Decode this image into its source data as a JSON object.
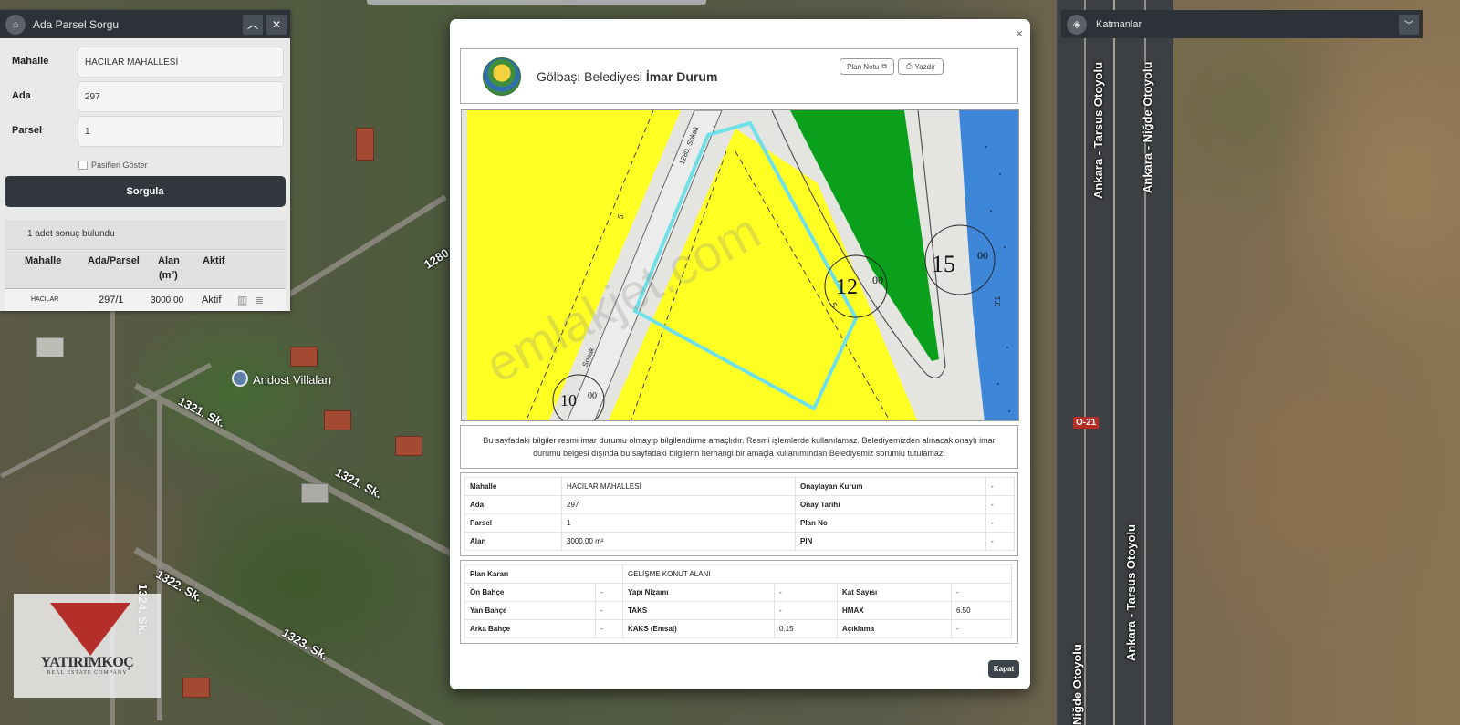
{
  "panel": {
    "title": "Ada Parsel Sorgu",
    "icon": "home-icon",
    "fields": [
      {
        "label": "Mahalle",
        "value": "HACILAR MAHALLESİ"
      },
      {
        "label": "Ada",
        "value": "297"
      },
      {
        "label": "Parsel",
        "value": "1"
      }
    ],
    "pasif_label": "Pasifleri Göster",
    "button": "Sorgula",
    "result_count": "1 adet sonuç bulundu",
    "columns": [
      "Mahalle",
      "Ada/Parsel",
      "Alan",
      "(m²)",
      "Aktif"
    ],
    "row": {
      "mahalle": "HACILAR",
      "ada_parsel": "297/1",
      "alan": "3000.00",
      "aktif": "Aktif"
    }
  },
  "layers": {
    "title": "Katmanlar",
    "icon": "layers-icon"
  },
  "map_labels": {
    "poi": "Andost Villaları",
    "road_1280": "1280",
    "road_1321a": "1321. Sk.",
    "road_1321b": "1321. Sk.",
    "road_1322": "1322. Sk.",
    "road_1324": "1324. Sk.",
    "road_1323": "1323. Sk.",
    "hwy_left": "Ankara - Tarsus Otoyolu",
    "hwy_right": "Ankara - Niğde Otoyolu",
    "hwy_left_bottom": "Niğde Otoyolu",
    "hwy_right_bottom": "Ankara - Tarsus Otoyolu",
    "shield": "O-21"
  },
  "logo": {
    "name": "YATIRIMKOÇ",
    "sub": "REAL ESTATE COMPANY"
  },
  "modal": {
    "close": "×",
    "title_prefix": "Gölbaşı Belediyesi ",
    "title_bold": "İmar Durum",
    "plan_notu": "Plan Notu",
    "yazdir": "Yazdır",
    "plan_labels": {
      "street_a": "1280. Sokak",
      "street_b": "Sokak",
      "n10": "10",
      "n12": "12",
      "n15": "15",
      "sub": "00",
      "s5a": "5",
      "s5b": "5",
      "s01": "0.1"
    },
    "watermark": "emlakjet.com",
    "disclaimer": "Bu sayfadaki bilgiler resmi imar durumu olmayıp bilgilendirme amaçlıdır. Resmi işlemlerde kullanılamaz. Belediyemizden alınacak onaylı imar durumu belgesi dışında bu sayfadaki bilgilerin herhangi bir amaçla kullanımından Belediyemiz sorumlu tutulamaz.",
    "info": {
      "mahalle_k": "Mahalle",
      "mahalle_v": "HACILAR MAHALLESİ",
      "ada_k": "Ada",
      "ada_v": "297",
      "parsel_k": "Parsel",
      "parsel_v": "1",
      "alan_k": "Alan",
      "alan_v": "3000.00 m²",
      "kurum_k": "Onaylayan Kurum",
      "kurum_v": "-",
      "tarih_k": "Onay Tarihi",
      "tarih_v": "-",
      "planno_k": "Plan No",
      "planno_v": "-",
      "pin_k": "PIN",
      "pin_v": "-"
    },
    "plan": {
      "karar_k": "Plan Kararı",
      "karar_v": "GELİŞME KONUT ALANI",
      "onbahce_k": "Ön Bahçe",
      "onbahce_v": "-",
      "yanbahce_k": "Yan Bahçe",
      "yanbahce_v": "-",
      "arkabahce_k": "Arka Bahçe",
      "arkabahce_v": "-",
      "nizam_k": "Yapı Nizamı",
      "nizam_v": "-",
      "taks_k": "TAKS",
      "taks_v": "-",
      "kaks_k": "KAKS (Emsal)",
      "kaks_v": "0.15",
      "kat_k": "Kat Sayısı",
      "kat_v": "-",
      "hmax_k": "HMAX",
      "hmax_v": "6.50",
      "aciklama_k": "Açıklama",
      "aciklama_v": "-"
    },
    "kapat": "Kapat"
  },
  "colors": {
    "yellow": "#ffff24",
    "green": "#0aa01c",
    "blue": "#3e86d8",
    "outline": "#6fe0e8",
    "panel_dark": "#2d3238"
  }
}
